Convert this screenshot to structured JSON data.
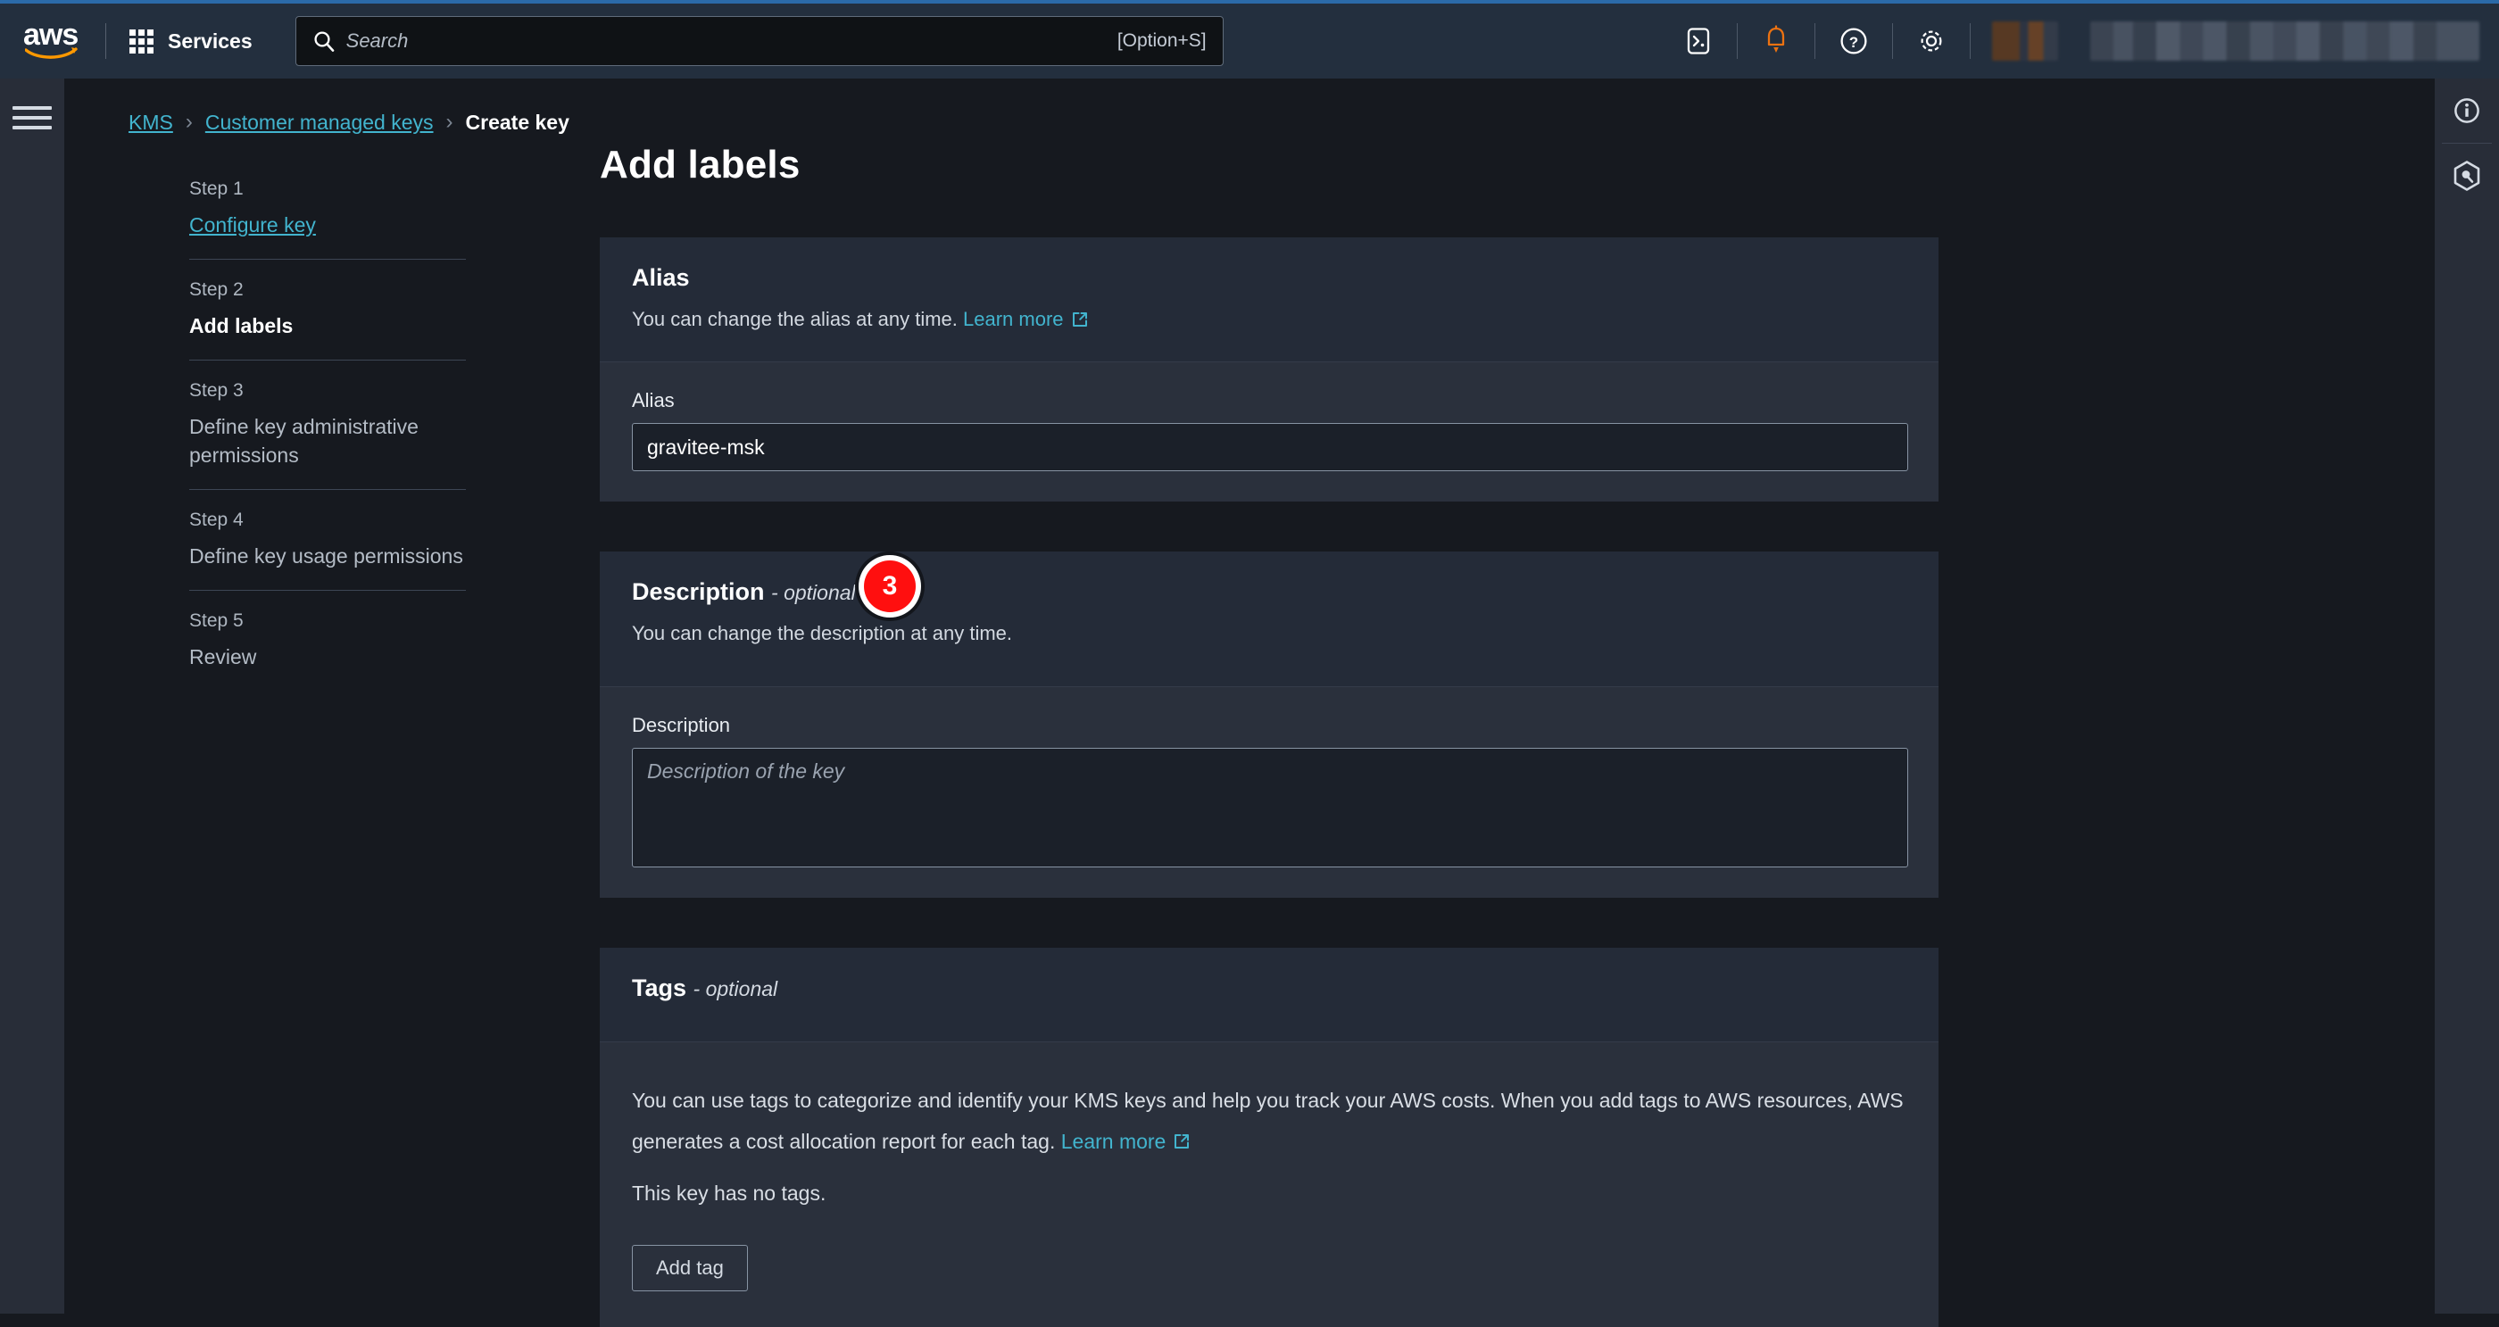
{
  "top_nav": {
    "logo_text": "aws",
    "services_label": "Services",
    "search": {
      "placeholder": "Search",
      "shortcut": "[Option+S]",
      "value": ""
    },
    "icons": [
      {
        "name": "cloudshell-icon",
        "label": "CloudShell"
      },
      {
        "name": "notifications-bell-icon",
        "label": "Notifications",
        "color": "#ec7211"
      },
      {
        "name": "help-question-icon",
        "label": "Help"
      },
      {
        "name": "settings-gear-icon",
        "label": "Settings"
      }
    ],
    "region_selector": "",
    "account_menu": ""
  },
  "left_rail": {
    "menu_icon": "hamburger-menu-icon"
  },
  "right_rail": {
    "items": [
      {
        "name": "info-panel-icon",
        "label": "Info"
      },
      {
        "name": "amazon-q-icon",
        "label": "Amazon Q"
      }
    ]
  },
  "breadcrumb": {
    "items": [
      {
        "label": "KMS",
        "current": false
      },
      {
        "label": "Customer managed keys",
        "current": false
      },
      {
        "label": "Create key",
        "current": true
      }
    ],
    "separator": "›"
  },
  "steps": [
    {
      "num": "Step 1",
      "title": "Configure key",
      "state": "link"
    },
    {
      "num": "Step 2",
      "title": "Add labels",
      "state": "current"
    },
    {
      "num": "Step 3",
      "title": "Define key administrative permissions",
      "state": "muted"
    },
    {
      "num": "Step 4",
      "title": "Define key usage permissions",
      "state": "muted"
    },
    {
      "num": "Step 5",
      "title": "Review",
      "state": "muted"
    }
  ],
  "main": {
    "page_title": "Add labels",
    "alias_card": {
      "title": "Alias",
      "description": "You can change the alias at any time.",
      "learn_more": "Learn more",
      "field_label": "Alias",
      "value": "gravitee-msk",
      "placeholder": ""
    },
    "description_card": {
      "title": "Description",
      "optional": "- optional",
      "description": "You can change the description at any time.",
      "field_label": "Description",
      "placeholder": "Description of the key",
      "value": ""
    },
    "tags_card": {
      "title": "Tags",
      "optional": "- optional",
      "body_line1": "You can use tags to categorize and identify your KMS keys and help you track your AWS costs. When you add tags to",
      "body_line2": "AWS resources, AWS generates a cost allocation report for each tag.",
      "learn_more": "Learn more",
      "no_tags": "This key has no tags.",
      "add_tag_button": "Add tag"
    }
  },
  "annotation": {
    "step_badge": "3"
  },
  "colors": {
    "nav_bg": "#232f3e",
    "page_bg": "#16191f",
    "rail_bg": "#282d38",
    "card_header_bg": "#242b38",
    "card_body_bg": "#2a303c",
    "link": "#42b4ce",
    "accent_orange": "#ec7211",
    "annotation_red": "#ff0f0f"
  }
}
